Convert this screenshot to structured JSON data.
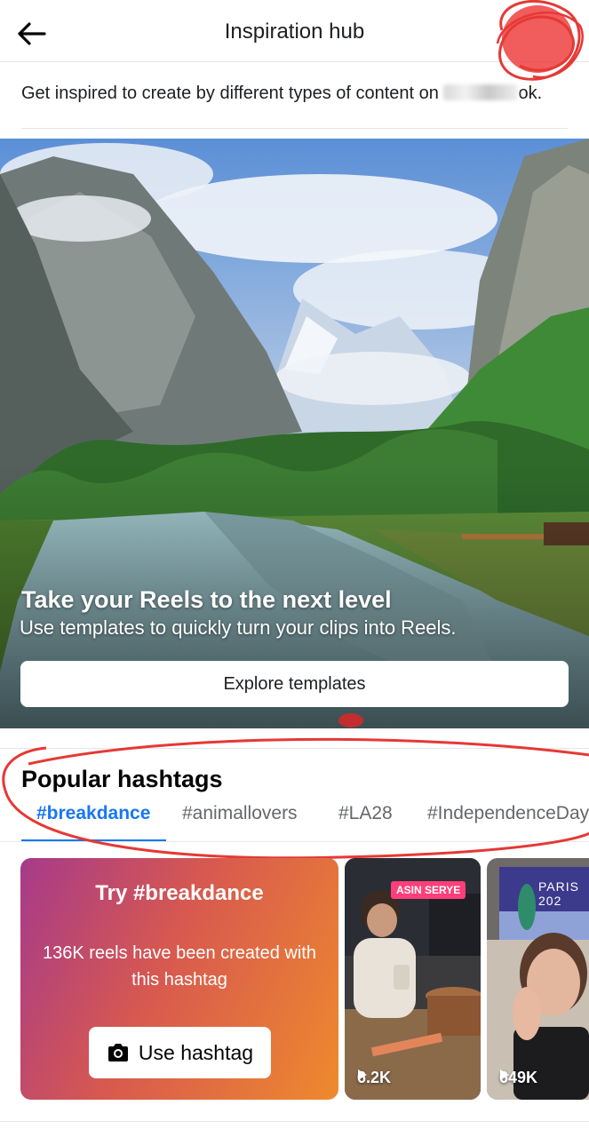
{
  "header": {
    "title": "Inspiration hub",
    "back_icon": "arrow-left-icon"
  },
  "subtitle": {
    "text": "Get inspired to create by different types of content on",
    "tail": "ok."
  },
  "hero": {
    "title": "Take your Reels to the next level",
    "description": "Use templates to quickly turn your clips into Reels.",
    "button_label": "Explore templates"
  },
  "hashtags": {
    "section_title": "Popular hashtags",
    "tabs": [
      {
        "label": "#breakdance",
        "active": true
      },
      {
        "label": "#animallovers",
        "active": false
      },
      {
        "label": "#LA28",
        "active": false
      },
      {
        "label": "#IndependenceDay",
        "active": false
      }
    ],
    "try_card": {
      "title": "Try #breakdance",
      "description": "136K reels have been created with this hashtag",
      "button_label": "Use hashtag",
      "button_icon": "camera-icon"
    },
    "reels": [
      {
        "badge": "ASIN SERYE",
        "views": "6.2K"
      },
      {
        "overlay_text": "PARIS 202",
        "views": "649K"
      }
    ]
  },
  "colors": {
    "accent": "#1877f2",
    "annotation": "#e53935",
    "card_gradient_start": "#a63a8a",
    "card_gradient_end": "#ee8a2d"
  }
}
